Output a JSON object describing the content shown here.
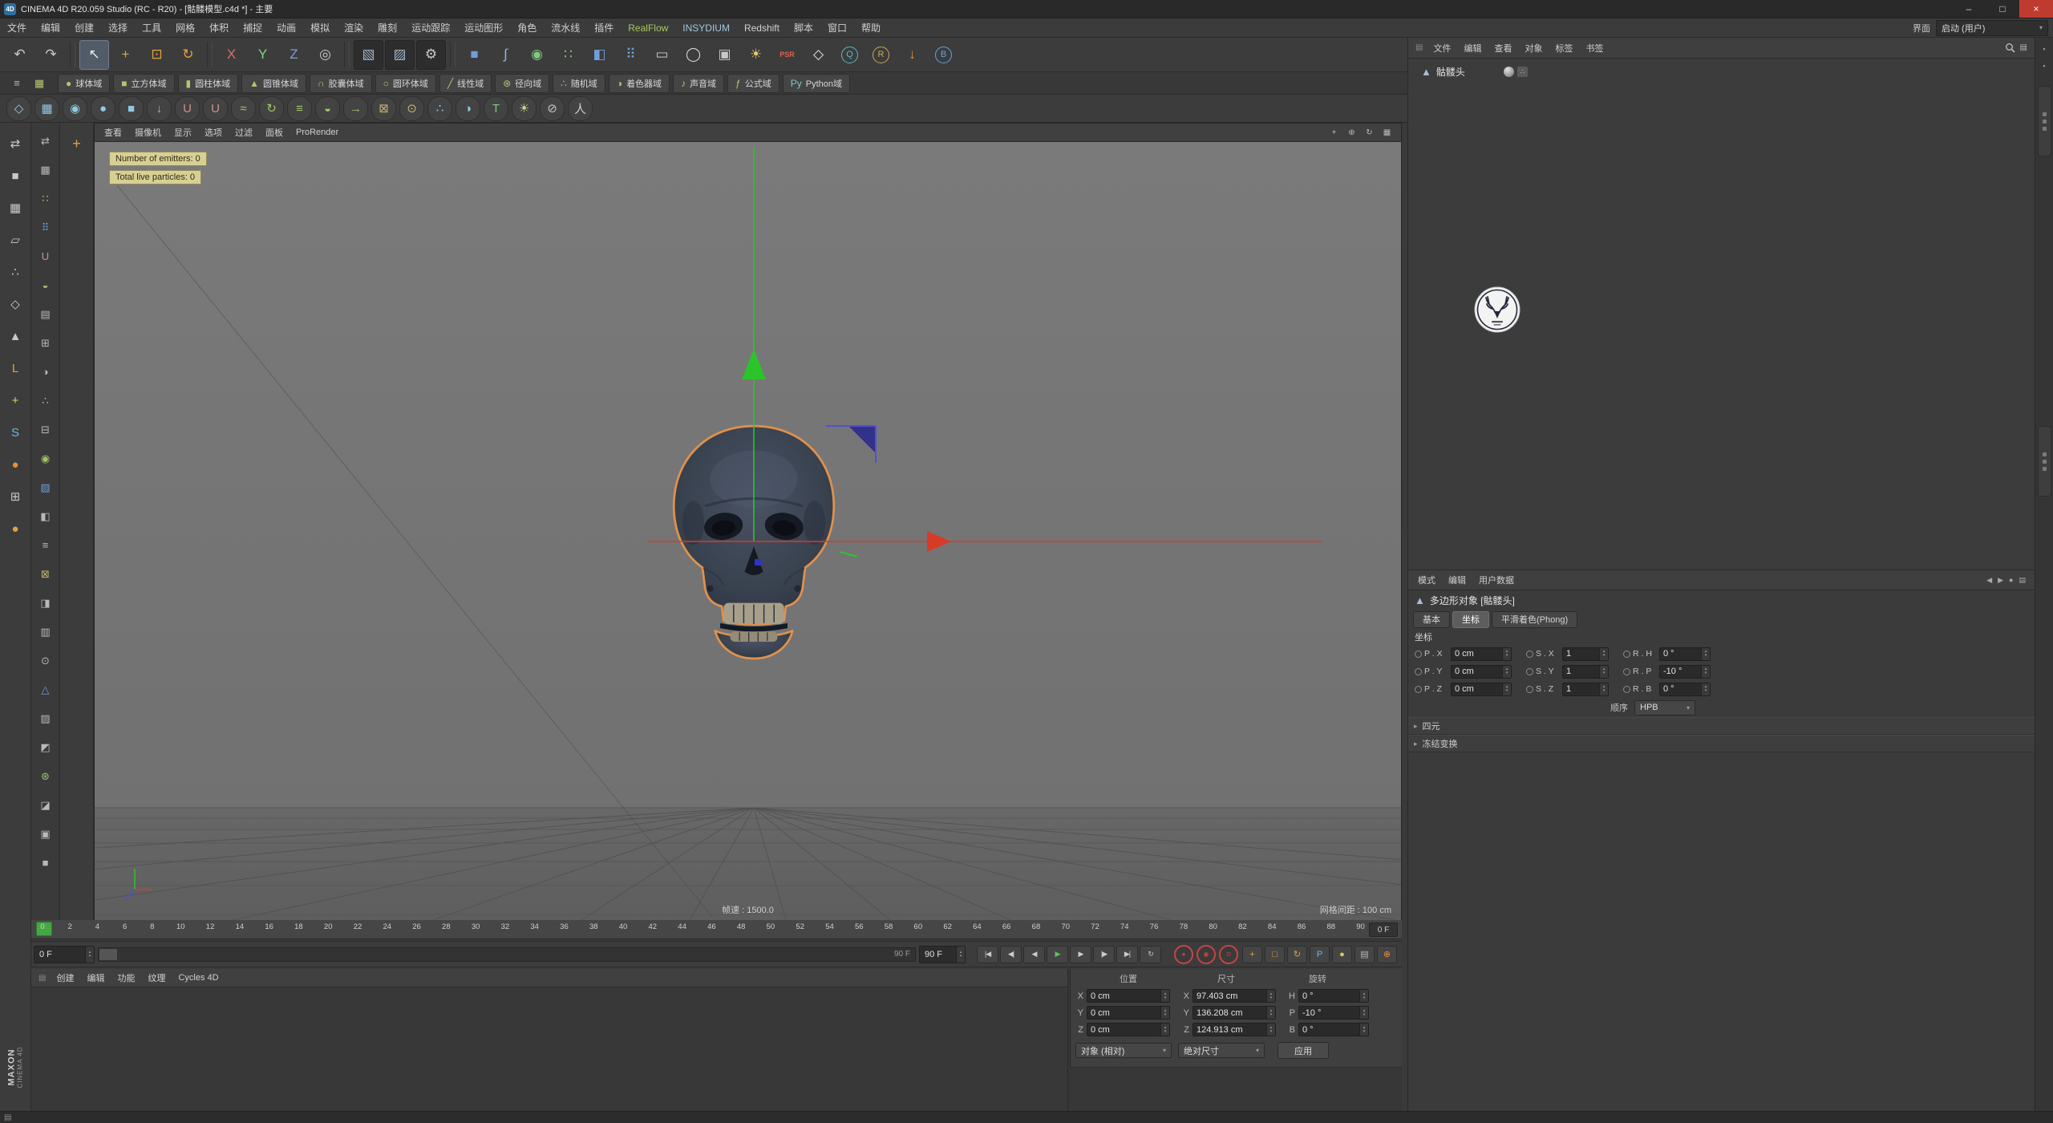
{
  "colors": {
    "axisGreen": "#2bc42b",
    "axisRed": "#d83a28",
    "axisBlue": "#2a35cc",
    "selOrange": "#e0914d",
    "recordRed": "#c84444",
    "playGreen": "#58c858",
    "tooltipBg": "#d8d093",
    "realflowGreen": "#a8c85a",
    "viewportSky": "#787878",
    "viewportGround": "#636363"
  },
  "window": {
    "logo_glyph": "4D",
    "title": "CINEMA 4D R20.059 Studio (RC - R20) - [骷髅模型.c4d *] - 主要",
    "minimize": "–",
    "maximize": "□",
    "close": "×"
  },
  "menubar": {
    "items": [
      {
        "label": "文件"
      },
      {
        "label": "编辑"
      },
      {
        "label": "创建"
      },
      {
        "label": "选择"
      },
      {
        "label": "工具"
      },
      {
        "label": "网格"
      },
      {
        "label": "体积"
      },
      {
        "label": "捕捉"
      },
      {
        "label": "动画"
      },
      {
        "label": "模拟"
      },
      {
        "label": "渲染"
      },
      {
        "label": "雕刻"
      },
      {
        "label": "运动跟踪"
      },
      {
        "label": "运动图形"
      },
      {
        "label": "角色"
      },
      {
        "label": "流水线"
      },
      {
        "label": "插件"
      },
      {
        "label": "RealFlow",
        "color": "#a8c85a"
      },
      {
        "label": "INSYDIUM",
        "color": "#9ec7dd"
      },
      {
        "label": "Redshift"
      },
      {
        "label": "脚本"
      },
      {
        "label": "窗口"
      },
      {
        "label": "帮助"
      }
    ],
    "interface_label": "界面",
    "layout_value": "启动 (用户)",
    "layout_caret": "▾"
  },
  "toolbar_main": {
    "icons": [
      {
        "name": "undo-icon",
        "glyph": "↶",
        "fg": "#c9c9c9"
      },
      {
        "name": "redo-icon",
        "glyph": "↷",
        "fg": "#c9c9c9"
      },
      {
        "sep": true
      },
      {
        "name": "live-selection-icon",
        "glyph": "↖",
        "fg": "#eaeaea",
        "active": true
      },
      {
        "name": "move-tool-icon",
        "glyph": "+",
        "fg": "#e3a23c"
      },
      {
        "name": "scale-tool-icon",
        "glyph": "⊡",
        "fg": "#e3a23c"
      },
      {
        "name": "rotate-tool-icon",
        "glyph": "↻",
        "fg": "#e3a23c"
      },
      {
        "sep": true
      },
      {
        "name": "lock-x-axis-icon",
        "glyph": "X",
        "fg": "#d87070"
      },
      {
        "name": "lock-y-axis-icon",
        "glyph": "Y",
        "fg": "#7ed87e"
      },
      {
        "name": "lock-z-axis-icon",
        "glyph": "Z",
        "fg": "#7e9ed8"
      },
      {
        "name": "coordinate-system-icon",
        "glyph": "◎",
        "fg": "#c9c9c9"
      },
      {
        "sep": true
      },
      {
        "name": "render-view-icon",
        "glyph": "▧",
        "fg": "#9fb6c9",
        "dark": true
      },
      {
        "name": "render-picture-viewer-icon",
        "glyph": "▨",
        "fg": "#9fb6c9",
        "dark": true
      },
      {
        "name": "render-settings-icon",
        "glyph": "⚙",
        "fg": "#c9c9c9",
        "dark": true
      },
      {
        "sep": true
      },
      {
        "name": "add-cube-icon",
        "glyph": "■",
        "fg": "#6f9fd8"
      },
      {
        "name": "spline-pen-icon",
        "glyph": "∫",
        "fg": "#8fb6e0"
      },
      {
        "name": "subdivision-surface-icon",
        "glyph": "◉",
        "fg": "#7ec97e"
      },
      {
        "name": "array-generator-icon",
        "glyph": "∷",
        "fg": "#7ec97e"
      },
      {
        "name": "deformer-icon",
        "glyph": "◧",
        "fg": "#6f9fd8"
      },
      {
        "name": "cloner-icon",
        "glyph": "⠿",
        "fg": "#6f9fd8"
      },
      {
        "name": "floor-icon",
        "glyph": "▭",
        "fg": "#c9c9c9"
      },
      {
        "name": "sky-icon",
        "glyph": "◯",
        "fg": "#d8d8d8"
      },
      {
        "name": "camera-icon",
        "glyph": "▣",
        "fg": "#c9c9c9"
      },
      {
        "name": "light-icon",
        "glyph": "☀",
        "fg": "#e8d060"
      },
      {
        "name": "psr-badge-icon",
        "glyph": "PSR",
        "fg": "#e06050",
        "small": true
      },
      {
        "name": "redshift-icon",
        "glyph": "◇",
        "fg": "#e8e8e8"
      },
      {
        "name": "quick-render-q-icon",
        "glyph": "Q",
        "fg": "#58b8c8",
        "circle": true
      },
      {
        "name": "quick-render-r-icon",
        "glyph": "R",
        "fg": "#c8a858",
        "circle": true
      },
      {
        "name": "realflow-download-icon",
        "glyph": "↓",
        "fg": "#e89030"
      },
      {
        "name": "bake-icon",
        "glyph": "B",
        "fg": "#58a8e0",
        "circle": true
      }
    ]
  },
  "fields_bar": {
    "lead_icons": [
      {
        "name": "field-list-icon",
        "glyph": "≡",
        "fg": "#b9b9b9"
      },
      {
        "name": "group-field-icon",
        "glyph": "▦",
        "fg": "#b9c470"
      }
    ],
    "buttons": [
      {
        "name": "spherical-field-button",
        "label": "球体域",
        "glyph": "●",
        "fg": "#b9c470"
      },
      {
        "name": "box-field-button",
        "label": "立方体域",
        "glyph": "■",
        "fg": "#b9c470"
      },
      {
        "name": "cylinder-field-button",
        "label": "圆柱体域",
        "glyph": "▮",
        "fg": "#b9c470"
      },
      {
        "name": "cone-field-button",
        "label": "圆锥体域",
        "glyph": "▲",
        "fg": "#b9c470"
      },
      {
        "name": "capsule-field-button",
        "label": "胶囊体域",
        "glyph": "∩",
        "fg": "#b9c470"
      },
      {
        "name": "torus-field-button",
        "label": "圆环体域",
        "glyph": "○",
        "fg": "#b9c470"
      },
      {
        "name": "linear-field-button",
        "label": "线性域",
        "glyph": "╱",
        "fg": "#b9c470"
      },
      {
        "name": "radial-field-button",
        "label": "径向域",
        "glyph": "⊛",
        "fg": "#b9c470"
      },
      {
        "name": "random-field-button",
        "label": "随机域",
        "glyph": "∴",
        "fg": "#b9c470"
      },
      {
        "name": "shader-field-button",
        "label": "着色器域",
        "glyph": "◑",
        "fg": "#b9c470"
      },
      {
        "name": "sound-field-button",
        "label": "声音域",
        "glyph": "♪",
        "fg": "#b9c470"
      },
      {
        "name": "formula-field-button",
        "label": "公式域",
        "glyph": "ƒ",
        "fg": "#b9c470"
      },
      {
        "name": "python-field-button",
        "label": "Python域",
        "glyph": "Py",
        "fg": "#7ec9c9"
      }
    ]
  },
  "toolbar_rf": {
    "icons": [
      {
        "name": "rf-mesher-icon",
        "glyph": "◇",
        "fg": "#8fc9e0"
      },
      {
        "name": "rf-volume-icon",
        "glyph": "▦",
        "fg": "#8fc9e0"
      },
      {
        "name": "rf-circle-emitter-icon",
        "glyph": "◉",
        "fg": "#8fc9e0"
      },
      {
        "name": "rf-sphere-emitter-icon",
        "glyph": "●",
        "fg": "#8fc9e0"
      },
      {
        "name": "rf-box-emitter-icon",
        "glyph": "■",
        "fg": "#8fc9e0"
      },
      {
        "name": "rf-gravity-daemon-icon",
        "glyph": "↓",
        "fg": "#9fc46a"
      },
      {
        "name": "rf-attractor-daemon-icon",
        "glyph": "U",
        "fg": "#d08f8f"
      },
      {
        "name": "rf-magnet-daemon-icon",
        "glyph": "U",
        "fg": "#d08f8f"
      },
      {
        "name": "rf-noise-daemon-icon",
        "glyph": "≈",
        "fg": "#9fc46a"
      },
      {
        "name": "rf-vortex-daemon-icon",
        "glyph": "↻",
        "fg": "#9fc46a"
      },
      {
        "name": "rf-drag-daemon-icon",
        "glyph": "≡",
        "fg": "#9fc46a"
      },
      {
        "name": "rf-surface-daemon-icon",
        "glyph": "◒",
        "fg": "#9fc46a"
      },
      {
        "name": "rf-wind-daemon-icon",
        "glyph": "→",
        "fg": "#9fc46a"
      },
      {
        "name": "rf-kvolume-daemon-icon",
        "glyph": "⊠",
        "fg": "#c9b36f"
      },
      {
        "name": "rf-ksphere-daemon-icon",
        "glyph": "⊙",
        "fg": "#c9b36f"
      },
      {
        "name": "rf-particle-skinner-icon",
        "glyph": "∴",
        "fg": "#8fc9e0"
      },
      {
        "name": "rf-fill-object-icon",
        "glyph": "◑",
        "fg": "#8fc9e0"
      },
      {
        "name": "rf-text-icon",
        "glyph": "T",
        "fg": "#7ec97e"
      },
      {
        "name": "rf-light-icon",
        "glyph": "☀",
        "fg": "#d8d890"
      },
      {
        "name": "rf-disable-icon",
        "glyph": "⊘",
        "fg": "#c9c9c9"
      },
      {
        "name": "rf-actor-icon",
        "glyph": "人",
        "fg": "#c9c9c9"
      }
    ]
  },
  "left_col1": {
    "icons": [
      {
        "name": "convert-editable-icon",
        "glyph": "⇄",
        "fg": "#c9c9c9"
      },
      {
        "name": "model-mode-icon",
        "glyph": "■",
        "fg": "#c9c9c9"
      },
      {
        "name": "texture-mode-icon",
        "glyph": "▦",
        "fg": "#c9c9c9"
      },
      {
        "name": "workplane-mode-icon",
        "glyph": "▱",
        "fg": "#c9c9c9"
      },
      {
        "name": "points-mode-icon",
        "glyph": "∴",
        "fg": "#c9c9c9"
      },
      {
        "name": "edges-mode-icon",
        "glyph": "◇",
        "fg": "#c9c9c9"
      },
      {
        "name": "polygons-mode-icon",
        "glyph": "▲",
        "fg": "#c9c9c9"
      },
      {
        "name": "axis-mode-icon",
        "glyph": "L",
        "fg": "#e3a23c"
      },
      {
        "name": "enable-axis-icon",
        "glyph": "+",
        "fg": "#e8d060"
      },
      {
        "name": "snap-toggle-icon",
        "glyph": "S",
        "fg": "#6fb8d8"
      },
      {
        "name": "paint-tool-icon",
        "glyph": "●",
        "fg": "#e89030"
      },
      {
        "name": "workplane-lock-icon",
        "glyph": "⊞",
        "fg": "#c9c9c9"
      },
      {
        "name": "sculpt-sphere-icon",
        "glyph": "●",
        "fg": "#e3a23c"
      }
    ]
  },
  "left_col2": {
    "icons": [
      {
        "name": "palette-icon-1",
        "glyph": "⇄",
        "fg": "#b9b9b9"
      },
      {
        "name": "palette-icon-2",
        "glyph": "▦",
        "fg": "#b9b9b9"
      },
      {
        "name": "palette-icon-3",
        "glyph": "∷",
        "fg": "#9fc46a"
      },
      {
        "name": "palette-icon-4",
        "glyph": "⠿",
        "fg": "#6f9fd8"
      },
      {
        "name": "palette-icon-5",
        "glyph": "U",
        "fg": "#d08f8f"
      },
      {
        "name": "palette-icon-6",
        "glyph": "◒",
        "fg": "#9fc46a"
      },
      {
        "name": "palette-icon-7",
        "glyph": "▤",
        "fg": "#b9b9b9"
      },
      {
        "name": "palette-icon-8",
        "glyph": "⊞",
        "fg": "#b9b9b9"
      },
      {
        "name": "palette-icon-9",
        "glyph": "◑",
        "fg": "#b9b9b9"
      },
      {
        "name": "palette-icon-10",
        "glyph": "∴",
        "fg": "#b9b9b9"
      },
      {
        "name": "palette-icon-11",
        "glyph": "⊟",
        "fg": "#b9b9b9"
      },
      {
        "name": "palette-icon-12",
        "glyph": "◉",
        "fg": "#9fc46a"
      },
      {
        "name": "palette-icon-13",
        "glyph": "▧",
        "fg": "#6f9fd8"
      },
      {
        "name": "palette-icon-14",
        "glyph": "◧",
        "fg": "#b9b9b9"
      },
      {
        "name": "palette-icon-15",
        "glyph": "≡",
        "fg": "#b9b9b9"
      },
      {
        "name": "palette-icon-16",
        "glyph": "⊠",
        "fg": "#c9b36f"
      },
      {
        "name": "palette-icon-17",
        "glyph": "◨",
        "fg": "#b9b9b9"
      },
      {
        "name": "palette-icon-18",
        "glyph": "▥",
        "fg": "#b9b9b9"
      },
      {
        "name": "palette-icon-19",
        "glyph": "⊙",
        "fg": "#b9b9b9"
      },
      {
        "name": "palette-icon-20",
        "glyph": "△",
        "fg": "#6f9fd8"
      },
      {
        "name": "palette-icon-21",
        "glyph": "▨",
        "fg": "#b9b9b9"
      },
      {
        "name": "palette-icon-22",
        "glyph": "◩",
        "fg": "#b9b9b9"
      },
      {
        "name": "palette-icon-23",
        "glyph": "⊛",
        "fg": "#9fc46a"
      },
      {
        "name": "palette-icon-24",
        "glyph": "◪",
        "fg": "#b9b9b9"
      },
      {
        "name": "palette-icon-25",
        "glyph": "▣",
        "fg": "#b9b9b9"
      },
      {
        "name": "palette-icon-26",
        "glyph": "■",
        "fg": "#b9b9b9"
      }
    ]
  },
  "strip": {
    "icon": {
      "name": "move-palette-icon",
      "glyph": "+",
      "fg": "#e3a23c"
    }
  },
  "viewport": {
    "menus": [
      "查看",
      "摄像机",
      "显示",
      "选项",
      "过滤",
      "面板",
      "ProRender"
    ],
    "corner_icons": [
      {
        "name": "pan-view-icon",
        "glyph": "+"
      },
      {
        "name": "zoom-view-icon",
        "glyph": "⊕"
      },
      {
        "name": "rotate-view-icon",
        "glyph": "↻"
      },
      {
        "name": "toggle-panels-icon",
        "glyph": "▦"
      }
    ],
    "tooltip": {
      "line1": "Number of emitters: 0",
      "line2": "Total live particles: 0"
    },
    "footer_left": "帧速 : 1500.0",
    "footer_right": "网格间距 : 100 cm"
  },
  "timeline": {
    "ticks": [
      "0",
      "2",
      "4",
      "6",
      "8",
      "10",
      "12",
      "14",
      "16",
      "18",
      "20",
      "22",
      "24",
      "26",
      "28",
      "30",
      "32",
      "34",
      "36",
      "38",
      "40",
      "42",
      "44",
      "46",
      "48",
      "50",
      "52",
      "54",
      "56",
      "58",
      "60",
      "62",
      "64",
      "66",
      "68",
      "70",
      "72",
      "74",
      "76",
      "78",
      "80",
      "82",
      "84",
      "86",
      "88",
      "90"
    ],
    "current_label": "0 F"
  },
  "transport": {
    "frame_start": "0 F",
    "track_end_label": "90 F",
    "frame_end": "90 F",
    "buttons": [
      {
        "name": "goto-start-button",
        "glyph": "|◀",
        "fg": "#cccccc"
      },
      {
        "name": "prev-key-button",
        "glyph": "◀|",
        "fg": "#cccccc"
      },
      {
        "name": "prev-frame-button",
        "glyph": "◀",
        "fg": "#cccccc"
      },
      {
        "name": "play-button",
        "glyph": "▶",
        "fg": "#58c858"
      },
      {
        "name": "next-frame-button",
        "glyph": "▶",
        "fg": "#cccccc"
      },
      {
        "name": "next-key-button",
        "glyph": "|▶",
        "fg": "#cccccc"
      },
      {
        "name": "goto-end-button",
        "glyph": "▶|",
        "fg": "#cccccc"
      },
      {
        "name": "loop-button",
        "glyph": "↻",
        "fg": "#cccccc"
      }
    ],
    "record_buttons": [
      {
        "name": "record-keyframe-button",
        "glyph": "●"
      },
      {
        "name": "autokey-button",
        "glyph": "◉"
      },
      {
        "name": "record-options-button",
        "glyph": "⊙"
      }
    ],
    "right_toggles": [
      {
        "name": "record-position-icon",
        "glyph": "+",
        "fg": "#e3a23c"
      },
      {
        "name": "record-scale-icon",
        "glyph": "□",
        "fg": "#e3a23c"
      },
      {
        "name": "record-rotation-icon",
        "glyph": "↻",
        "fg": "#e3a23c"
      },
      {
        "name": "record-parameter-icon",
        "glyph": "P",
        "fg": "#6fb8d8"
      },
      {
        "name": "record-pla-icon",
        "glyph": "●",
        "fg": "#d8c860"
      },
      {
        "name": "keying-settings-icon",
        "glyph": "▤",
        "fg": "#b9b9b9"
      },
      {
        "name": "rf-cache-icon",
        "glyph": "⊕",
        "fg": "#e89030"
      }
    ]
  },
  "materials": {
    "menus": [
      "创建",
      "编辑",
      "功能",
      "纹理",
      "Cycles 4D"
    ]
  },
  "coords": {
    "headers": [
      "位置",
      "尺寸",
      "旋转"
    ],
    "rows": [
      {
        "l1": "X",
        "v1": "0 cm",
        "l2": "X",
        "v2": "97.403 cm",
        "l3": "H",
        "v3": "0 °"
      },
      {
        "l1": "Y",
        "v1": "0 cm",
        "l2": "Y",
        "v2": "136.208 cm",
        "l3": "P",
        "v3": "-10 °"
      },
      {
        "l1": "Z",
        "v1": "0 cm",
        "l2": "Z",
        "v2": "124.913 cm",
        "l3": "B",
        "v3": "0 °"
      }
    ],
    "mode_dropdown": "对象 (相对)",
    "size_dropdown": "绝对尺寸",
    "apply_label": "应用"
  },
  "object_manager": {
    "menus": [
      "文件",
      "编辑",
      "查看",
      "对象",
      "标签",
      "书签"
    ],
    "objects": [
      {
        "name": "骷髅头"
      }
    ],
    "tags": [
      {
        "name": "phong-tag-icon"
      },
      {
        "name": "selection-tag-icon"
      }
    ]
  },
  "attributes": {
    "menus": [
      "模式",
      "编辑",
      "用户数据"
    ],
    "title": "多边形对象 [骷髅头]",
    "tabs": [
      {
        "label": "基本"
      },
      {
        "label": "坐标",
        "active": true
      },
      {
        "label": "平滑着色(Phong)"
      }
    ],
    "section": "坐标",
    "rows": [
      {
        "c1": "P . X",
        "v1": "0 cm",
        "c2": "S . X",
        "v2": "1",
        "c3": "R . H",
        "v3": "0 °"
      },
      {
        "c1": "P . Y",
        "v1": "0 cm",
        "c2": "S . Y",
        "v2": "1",
        "c3": "R . P",
        "v3": "-10 °"
      },
      {
        "c1": "P . Z",
        "v1": "0 cm",
        "c2": "S . Z",
        "v2": "1",
        "c3": "R . B",
        "v3": "0 °"
      }
    ],
    "order_label": "顺序",
    "order_value": "HPB",
    "collapsed": [
      "四元",
      "冻结变换"
    ]
  },
  "branding": {
    "line1": "MAXON",
    "line2": "CINEMA 4D"
  }
}
